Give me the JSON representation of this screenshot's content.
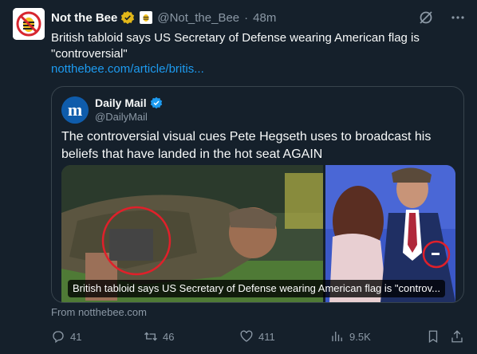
{
  "post": {
    "author_name": "Not the Bee",
    "author_handle": "@Not_the_Bee",
    "timestamp": "48m",
    "separator": "·",
    "text": "British tabloid says US Secretary of Defense wearing American flag is \"controversial\"",
    "link_text": "notthebee.com/article/britis...",
    "source_label": "From notthebee.com",
    "icons": {
      "grok": "grok-slash-icon",
      "more": "more-dots-icon"
    }
  },
  "quote": {
    "author_name": "Daily Mail",
    "author_handle": "@DailyMail",
    "logo_letter": "m",
    "text": "The controversial visual cues Pete Hegseth uses to broadcast his beliefs that have landed in the hot seat AGAIN",
    "caption": "British tabloid says US Secretary of Defense wearing American flag is \"controv..."
  },
  "stats": {
    "replies": "41",
    "reposts": "46",
    "likes": "411",
    "views": "9.5K"
  },
  "colors": {
    "background": "#15202b",
    "text": "#f7f9f9",
    "muted": "#8b98a5",
    "link": "#1d9bf0",
    "verified_gold": "#e2b719",
    "verified_blue": "#1d9bf0",
    "highlight_circle": "#e0202a"
  }
}
